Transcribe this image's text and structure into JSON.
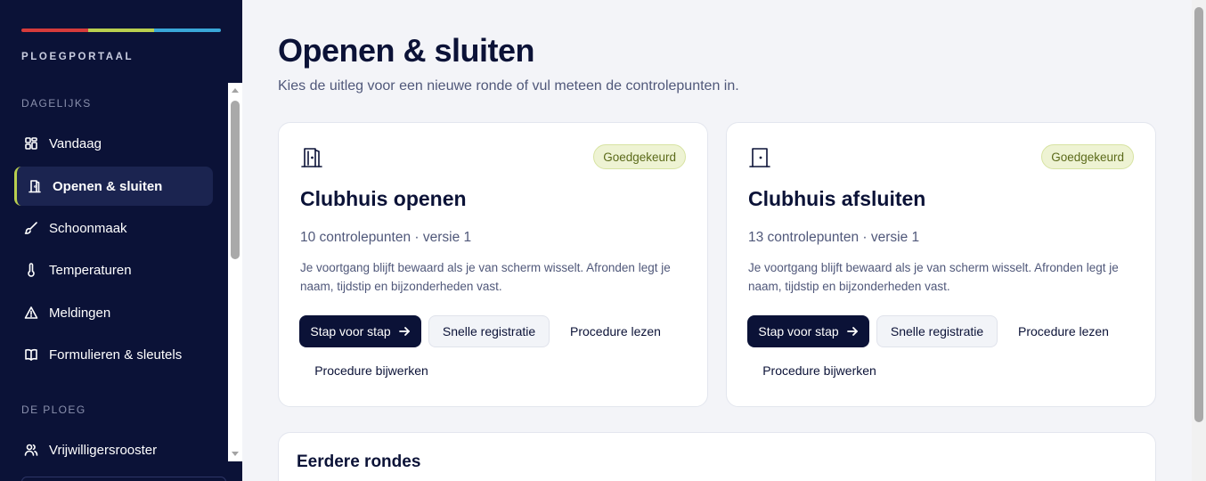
{
  "colors": {
    "stripe": [
      "#d63b3b",
      "#b9cf4f",
      "#3aa7d8"
    ],
    "sidebar_bg": "#0b1237",
    "active_accent": "#b9cf4f",
    "badge_bg": "#eef3d3"
  },
  "sidebar": {
    "brand": "PLOEGPORTAAL",
    "section_daily": "DAGELIJKS",
    "section_team": "DE PLOEG",
    "items": [
      {
        "label": "Vandaag",
        "icon": "grid-icon"
      },
      {
        "label": "Openen & sluiten",
        "icon": "door-icon",
        "active": true
      },
      {
        "label": "Schoonmaak",
        "icon": "brush-icon"
      },
      {
        "label": "Temperaturen",
        "icon": "thermometer-icon"
      },
      {
        "label": "Meldingen",
        "icon": "warning-icon"
      },
      {
        "label": "Formulieren & sleutels",
        "icon": "book-icon"
      },
      {
        "label": "Vrijwilligersrooster",
        "icon": "users-icon"
      }
    ]
  },
  "page": {
    "title": "Openen & sluiten",
    "subtitle": "Kies de uitleg voor een nieuwe ronde of vul meteen de controlepunten in."
  },
  "cards": [
    {
      "icon": "door-open-icon",
      "badge": "Goedgekeurd",
      "title": "Clubhuis openen",
      "meta": "10 controlepunten · versie 1",
      "description": "Je voortgang blijft bewaard als je van scherm wisselt. Afronden legt je naam, tijdstip en bijzonderheden vast.",
      "primary": "Stap voor stap",
      "secondary": "Snelle registratie",
      "read": "Procedure lezen",
      "update": "Procedure bijwerken"
    },
    {
      "icon": "door-closed-icon",
      "badge": "Goedgekeurd",
      "title": "Clubhuis afsluiten",
      "meta": "13 controlepunten · versie 1",
      "description": "Je voortgang blijft bewaard als je van scherm wisselt. Afronden legt je naam, tijdstip en bijzonderheden vast.",
      "primary": "Stap voor stap",
      "secondary": "Snelle registratie",
      "read": "Procedure lezen",
      "update": "Procedure bijwerken"
    }
  ],
  "history": {
    "title": "Eerdere rondes"
  }
}
